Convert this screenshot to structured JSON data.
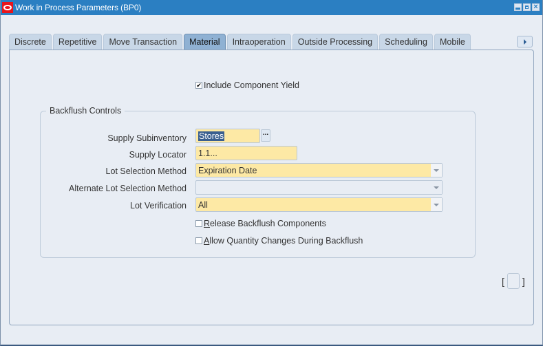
{
  "window": {
    "title": "Work in Process Parameters (BP0)",
    "controls": [
      "minimize-icon",
      "maximize-icon",
      "close-icon"
    ]
  },
  "tabs": [
    {
      "label": "Discrete",
      "active": false
    },
    {
      "label": "Repetitive",
      "active": false
    },
    {
      "label": "Move Transaction",
      "active": false
    },
    {
      "label": "Material",
      "active": true
    },
    {
      "label": "Intraoperation",
      "active": false
    },
    {
      "label": "Outside Processing",
      "active": false
    },
    {
      "label": "Scheduling",
      "active": false
    },
    {
      "label": "Mobile",
      "active": false
    }
  ],
  "tab_scroll_icon": "arrow-right-icon",
  "material": {
    "include_component_yield": {
      "label": "Include Component Yield",
      "checked": true
    },
    "backflush_controls": {
      "title": "Backflush Controls",
      "supply_subinventory": {
        "label": "Supply Subinventory",
        "value": "Stores",
        "lov_label": "..."
      },
      "supply_locator": {
        "label": "Supply Locator",
        "value": "1.1..."
      },
      "lot_selection_method": {
        "label": "Lot Selection Method",
        "value": "Expiration Date"
      },
      "alternate_lot_selection_method": {
        "label": "Alternate Lot Selection Method",
        "value": ""
      },
      "lot_verification": {
        "label": "Lot Verification",
        "value": "All"
      },
      "release_backflush_components": {
        "label_mnemonic": "R",
        "label_rest": "elease Backflush Components",
        "checked": false
      },
      "allow_quantity_changes": {
        "label_mnemonic": "A",
        "label_rest": "llow Quantity Changes During Backflush",
        "checked": false
      }
    }
  },
  "flex_field": {
    "open": "[",
    "close": "]"
  }
}
